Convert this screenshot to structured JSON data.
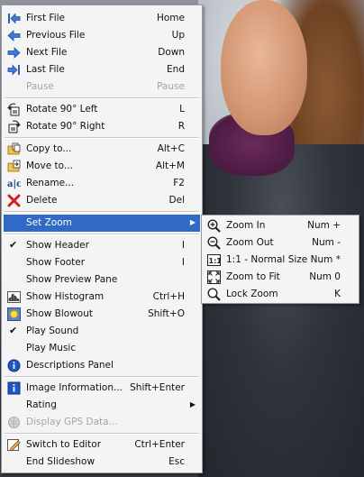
{
  "menu": {
    "group1": [
      {
        "label": "First File",
        "shortcut": "Home",
        "icon": "first-file-icon",
        "enabled": true
      },
      {
        "label": "Previous File",
        "shortcut": "Up",
        "icon": "previous-file-icon",
        "enabled": true
      },
      {
        "label": "Next File",
        "shortcut": "Down",
        "icon": "next-file-icon",
        "enabled": true
      },
      {
        "label": "Last File",
        "shortcut": "End",
        "icon": "last-file-icon",
        "enabled": true
      },
      {
        "label": "Pause",
        "shortcut": "Pause",
        "icon": "",
        "enabled": false
      }
    ],
    "group2": [
      {
        "label": "Rotate 90° Left",
        "shortcut": "L",
        "icon": "rotate-left-icon",
        "enabled": true
      },
      {
        "label": "Rotate 90° Right",
        "shortcut": "R",
        "icon": "rotate-right-icon",
        "enabled": true
      }
    ],
    "group3": [
      {
        "label": "Copy to...",
        "shortcut": "Alt+C",
        "icon": "copy-to-icon",
        "enabled": true
      },
      {
        "label": "Move to...",
        "shortcut": "Alt+M",
        "icon": "move-to-icon",
        "enabled": true
      },
      {
        "label": "Rename...",
        "shortcut": "F2",
        "icon": "rename-icon",
        "enabled": true
      },
      {
        "label": "Delete",
        "shortcut": "Del",
        "icon": "delete-icon",
        "enabled": true
      }
    ],
    "set_zoom": {
      "label": "Set Zoom",
      "highlighted": true
    },
    "group5": [
      {
        "label": "Show Header",
        "shortcut": "I",
        "checked": true
      },
      {
        "label": "Show Footer",
        "shortcut": "I",
        "checked": false
      },
      {
        "label": "Show Preview Pane",
        "shortcut": "",
        "checked": false
      },
      {
        "label": "Show Histogram",
        "shortcut": "Ctrl+H",
        "icon": "histogram-icon"
      },
      {
        "label": "Show Blowout",
        "shortcut": "Shift+O",
        "icon": "blowout-icon"
      },
      {
        "label": "Play Sound",
        "shortcut": "",
        "checked": true
      },
      {
        "label": "Play Music",
        "shortcut": ""
      },
      {
        "label": "Descriptions Panel",
        "shortcut": "",
        "icon": "info-icon"
      }
    ],
    "group6": [
      {
        "label": "Image Information...",
        "shortcut": "Shift+Enter",
        "icon": "image-info-icon"
      },
      {
        "label": "Rating",
        "submenu": true
      },
      {
        "label": "Display GPS Data...",
        "enabled": false,
        "icon": "gps-icon"
      }
    ],
    "group7": [
      {
        "label": "Switch to Editor",
        "shortcut": "Ctrl+Enter",
        "icon": "editor-icon"
      },
      {
        "label": "End Slideshow",
        "shortcut": "Esc"
      }
    ]
  },
  "zoom_submenu": [
    {
      "label": "Zoom In",
      "shortcut": "Num +",
      "icon": "zoom-in-icon"
    },
    {
      "label": "Zoom Out",
      "shortcut": "Num -",
      "icon": "zoom-out-icon"
    },
    {
      "label": "1:1 - Normal Size",
      "shortcut": "Num *",
      "icon": "actual-size-icon"
    },
    {
      "label": "Zoom to Fit",
      "shortcut": "Num 0",
      "icon": "fit-icon"
    },
    {
      "label": "Lock Zoom",
      "shortcut": "K",
      "icon": "lock-zoom-icon"
    }
  ],
  "colors": {
    "highlight": "#3169c6",
    "menu_bg": "#f4f4f4",
    "disabled": "#a5a5a5"
  }
}
